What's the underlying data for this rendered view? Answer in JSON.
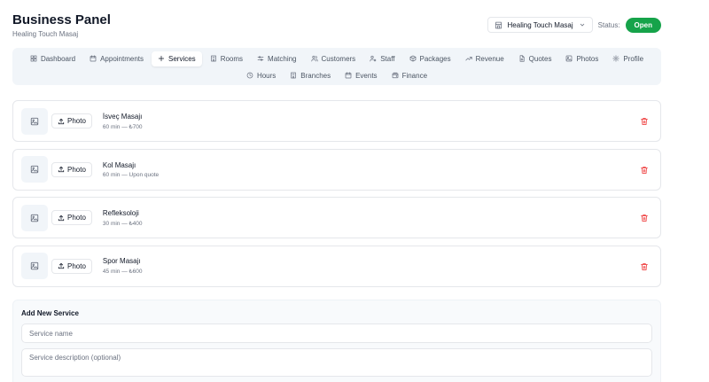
{
  "header": {
    "title": "Business Panel",
    "subtitle": "Healing Touch Masaj",
    "business_select": "Healing Touch Masaj",
    "status_label": "Status:",
    "status_value": "Open"
  },
  "nav": {
    "row1": [
      {
        "label": "Dashboard",
        "icon": "grid-icon"
      },
      {
        "label": "Appointments",
        "icon": "calendar-icon"
      },
      {
        "label": "Services",
        "icon": "plus-icon",
        "active": true
      },
      {
        "label": "Rooms",
        "icon": "building-icon"
      },
      {
        "label": "Matching",
        "icon": "sliders-icon"
      },
      {
        "label": "Customers",
        "icon": "users-icon"
      },
      {
        "label": "Staff",
        "icon": "user-cog-icon"
      },
      {
        "label": "Packages",
        "icon": "package-icon"
      },
      {
        "label": "Revenue",
        "icon": "trend-up-icon"
      },
      {
        "label": "Quotes",
        "icon": "file-icon"
      },
      {
        "label": "Photos",
        "icon": "image-icon"
      },
      {
        "label": "Profile",
        "icon": "gear-icon"
      }
    ],
    "row2": [
      {
        "label": "Hours",
        "icon": "clock-icon"
      },
      {
        "label": "Branches",
        "icon": "building-icon"
      },
      {
        "label": "Events",
        "icon": "calendar-icon"
      },
      {
        "label": "Finance",
        "icon": "wallet-icon"
      }
    ]
  },
  "services": [
    {
      "name": "İsveç Masajı",
      "meta": "60 min — ₺700",
      "photo_label": "Photo"
    },
    {
      "name": "Kol Masajı",
      "meta": "60 min — Upon quote",
      "photo_label": "Photo"
    },
    {
      "name": "Refleksoloji",
      "meta": "30 min — ₺400",
      "photo_label": "Photo"
    },
    {
      "name": "Spor Masajı",
      "meta": "45 min — ₺600",
      "photo_label": "Photo"
    }
  ],
  "add_service": {
    "title": "Add New Service",
    "name_placeholder": "Service name",
    "description_placeholder": "Service description (optional)"
  },
  "colors": {
    "accent_green": "#16a34a",
    "delete_red": "#ef4444",
    "nav_bg": "#f1f5f9"
  }
}
